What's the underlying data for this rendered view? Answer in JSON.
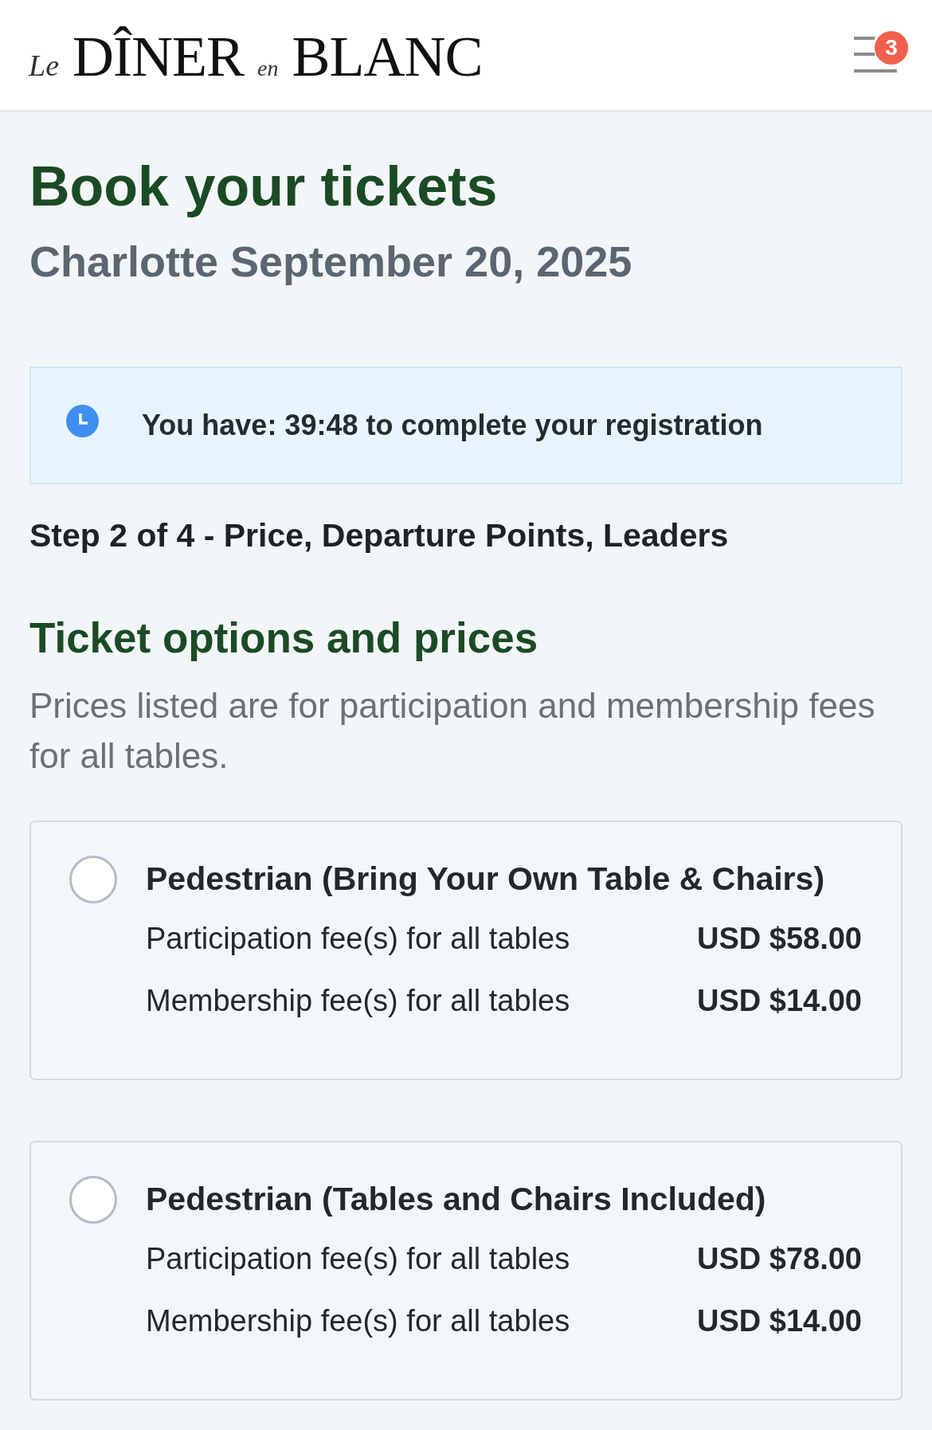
{
  "header": {
    "logo": "*Le* DÎNER *en* BLANC",
    "menu": {
      "badge": "3"
    }
  },
  "page": {
    "title": "Book your tickets",
    "subtitle": "Charlotte September 20, 2025"
  },
  "timer_banner": {
    "text": "You have: 39:48 to complete your registration"
  },
  "step": "Step 2 of 4 - Price, Departure Points, Leaders",
  "ticket_section": {
    "title": "Ticket options and prices",
    "description": "Prices listed are for participation and membership fees for all tables.",
    "options": [
      {
        "name": "Pedestrian (Bring Your Own Table & Chairs)",
        "selected": false,
        "fees": [
          {
            "label": "Participation fee(s) for all tables",
            "amount": "USD $58.00"
          },
          {
            "label": "Membership fee(s) for all tables",
            "amount": "USD $14.00"
          }
        ]
      },
      {
        "name": "Pedestrian (Tables and Chairs Included)",
        "selected": false,
        "fees": [
          {
            "label": "Participation fee(s) for all tables",
            "amount": "USD $78.00"
          },
          {
            "label": "Membership fee(s) for all tables",
            "amount": "USD $14.00"
          }
        ]
      }
    ]
  }
}
